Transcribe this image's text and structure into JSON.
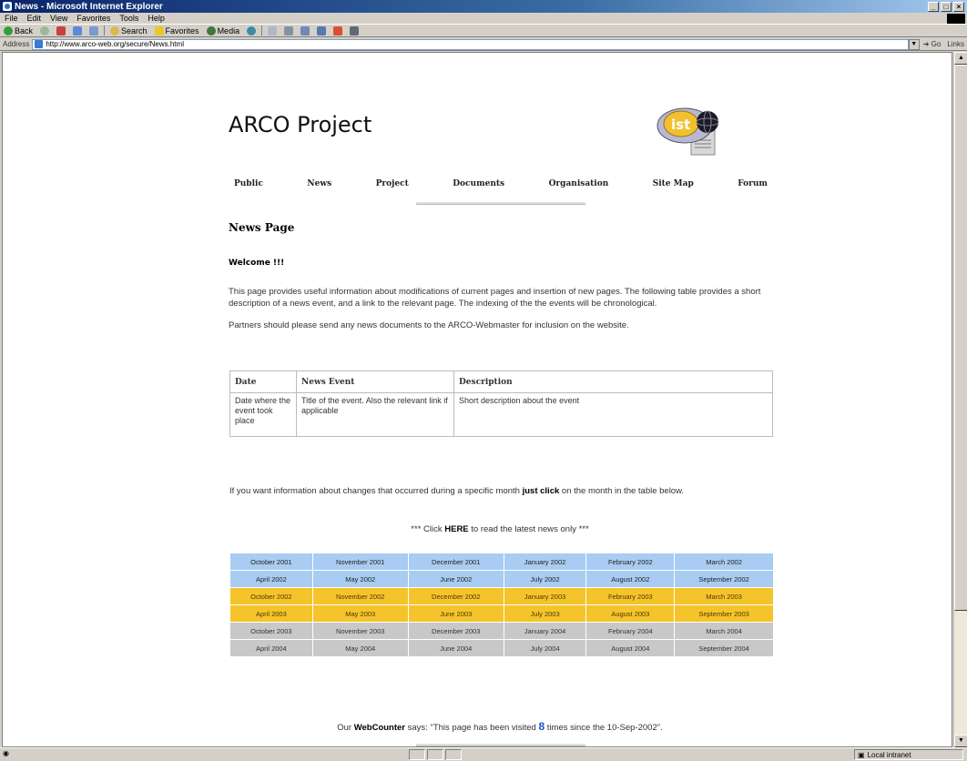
{
  "window": {
    "title": "News - Microsoft Internet Explorer",
    "controls": [
      "_",
      "□",
      "×"
    ]
  },
  "menu": [
    "File",
    "Edit",
    "View",
    "Favorites",
    "Tools",
    "Help"
  ],
  "toolbar": {
    "back": "Back",
    "search": "Search",
    "favorites": "Favorites",
    "media": "Media"
  },
  "address": {
    "label": "Address",
    "url": "http://www.arco-web.org/secure/News.html",
    "go": "Go",
    "links": "Links"
  },
  "status": {
    "zone": "Local intranet"
  },
  "page": {
    "site_title": "ARCO Project",
    "logo_text": "ist",
    "nav": [
      "Public",
      "News",
      "Project",
      "Documents",
      "Organisation",
      "Site Map",
      "Forum"
    ],
    "heading": "News Page",
    "welcome": "Welcome !!!",
    "intro": "This page provides useful information about modifications of current pages and insertion of new pages. The following table provides a short description of a news event, and a link to the relevant page. The indexing of the the events will be chronological.",
    "partners": "Partners should please send any news documents to the ARCO-Webmaster for inclusion on the website.",
    "desc_table": {
      "headers": [
        "Date",
        "News Event",
        "Description"
      ],
      "row": [
        "Date where the event took place",
        "Title of the event. Also the relevant link if applicable",
        "Short description about the event"
      ]
    },
    "month_info_pre": "If you want information about changes that occurred during a specific month ",
    "month_info_bold": "just click",
    "month_info_post": " on the month in the table below.",
    "click_pre": "*** Click ",
    "click_bold": "HERE",
    "click_post": " to read the latest news only ***",
    "months": {
      "blue": [
        [
          "October 2001",
          "November 2001",
          "December 2001",
          "January 2002",
          "February 2002",
          "March 2002"
        ],
        [
          "April 2002",
          "May 2002",
          "June 2002",
          "July 2002",
          "August 2002",
          "September 2002"
        ]
      ],
      "yellow": [
        [
          "October 2002",
          "November 2002",
          "December 2002",
          "January 2003",
          "February 2003",
          "March 2003"
        ],
        [
          "April 2003",
          "May 2003",
          "June 2003",
          "July 2003",
          "August 2003",
          "September 2003"
        ]
      ],
      "gray": [
        [
          "October 2003",
          "November 2003",
          "December 2003",
          "January 2004",
          "February 2004",
          "March 2004"
        ],
        [
          "April 2004",
          "May 2004",
          "June 2004",
          "July 2004",
          "August 2004",
          "September 2004"
        ]
      ]
    },
    "counter_pre": "Our ",
    "counter_bold": "WebCounter",
    "counter_mid": " says: \"This page has been visited ",
    "counter_value": "8",
    "counter_post": " times since the 10-Sep-2002\"."
  }
}
